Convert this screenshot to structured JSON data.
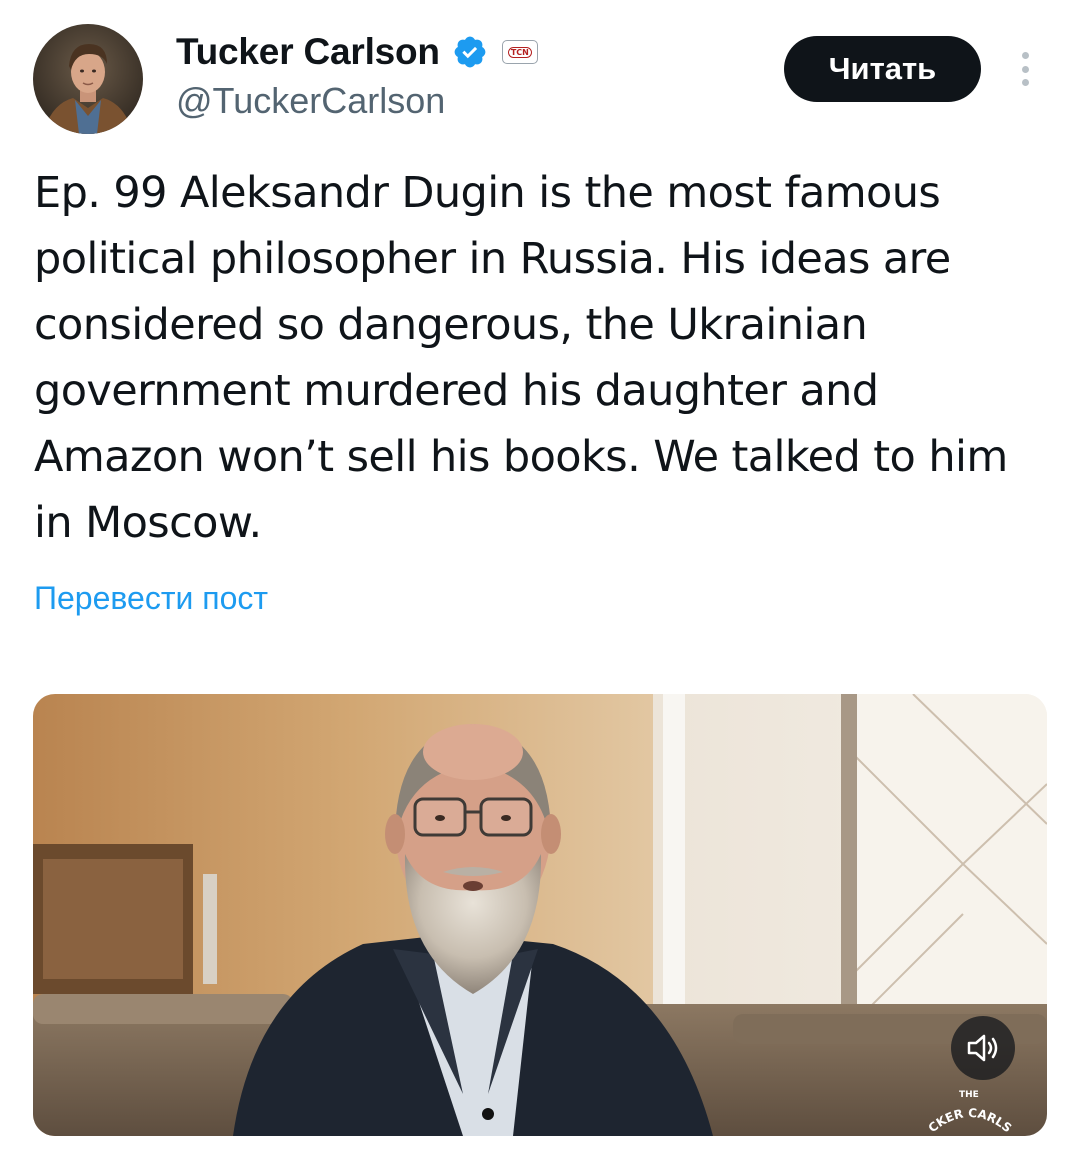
{
  "author": {
    "display_name": "Tucker Carlson",
    "handle": "@TuckerCarlson",
    "verified_icon": "verified-badge-icon",
    "affiliation_badge": "TCN"
  },
  "actions": {
    "read_label": "Читать",
    "more_icon": "more-vertical-icon"
  },
  "tweet": {
    "text": "Ep. 99  Aleksandr Dugin is the most famous political philosopher in Russia. His ideas are considered so dangerous, the Ukrainian government murdered his daughter and Amazon won’t sell his books. We talked to him in Moscow.",
    "translate_label": "Перевести пост"
  },
  "media": {
    "type": "video",
    "sound_icon": "speaker-volume-icon",
    "watermark_top": "THE",
    "watermark_arc": "CKER CARLS"
  },
  "colors": {
    "text_primary": "#0f1419",
    "text_secondary": "#536471",
    "link": "#1d9bf0",
    "button_bg": "#0f1419",
    "verified": "#1d9bf0"
  }
}
